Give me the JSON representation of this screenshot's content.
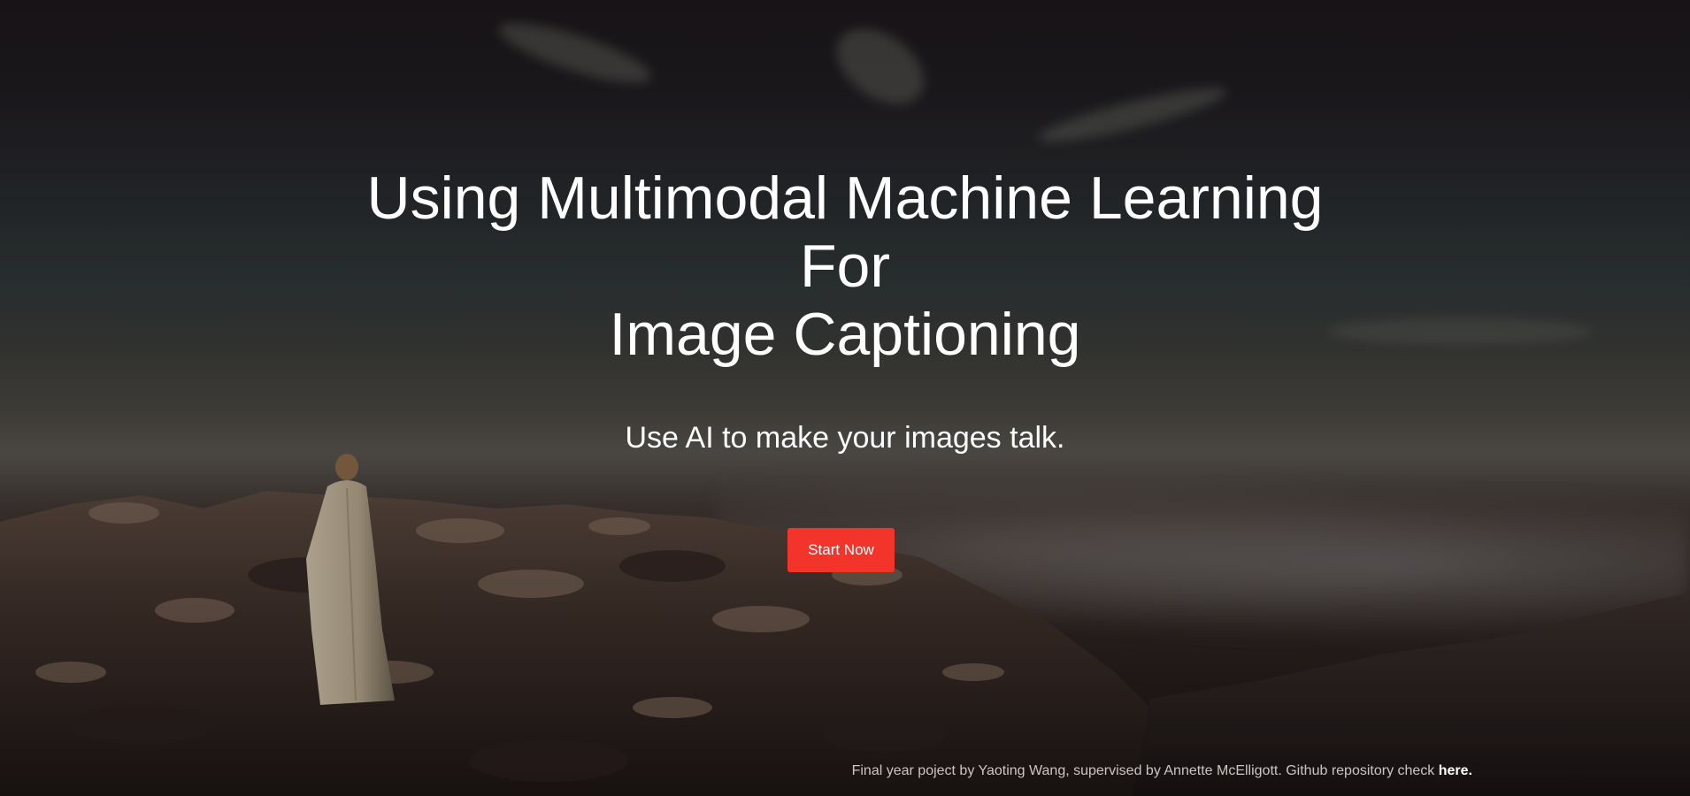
{
  "hero": {
    "title_lines": [
      "Using Multimodal Machine Learning",
      "For",
      "Image Captioning"
    ],
    "subtitle": "Use AI to make your images talk.",
    "start_button_label": "Start Now"
  },
  "footer": {
    "text": "Final year poject by Yaoting Wang, supervised by Annette McElligott. Github repository check ",
    "link_label": "here."
  },
  "colors": {
    "accent": "#f2342b",
    "text": "#ffffff",
    "footer_text": "#c9c6c4"
  }
}
